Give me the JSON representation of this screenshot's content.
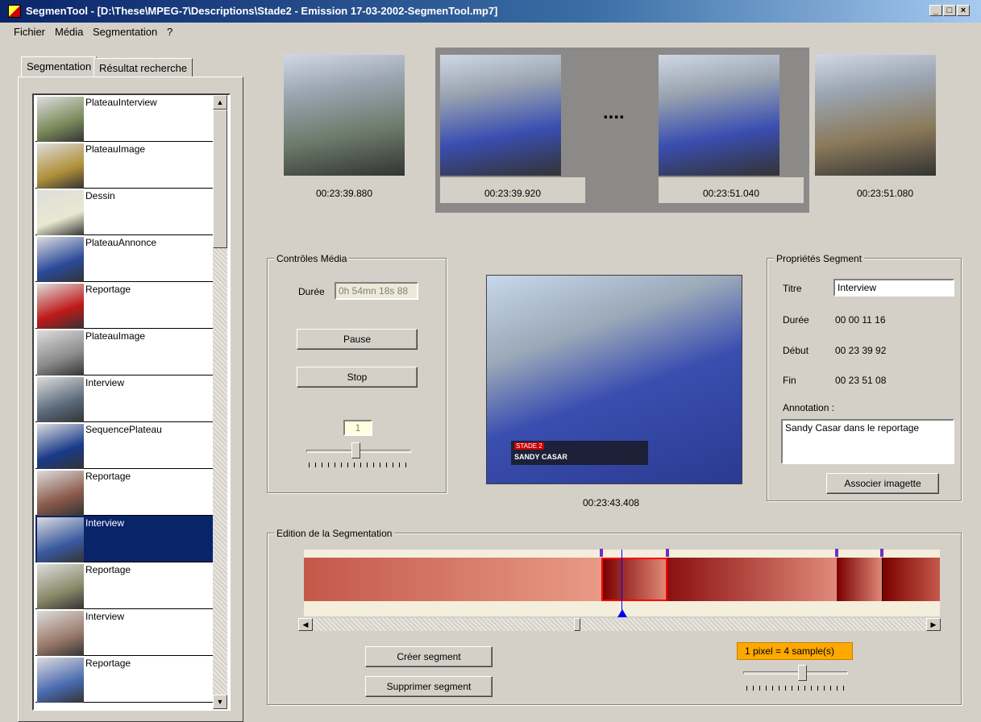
{
  "window": {
    "title": "SegmenTool -  [D:\\These\\MPEG-7\\Descriptions\\Stade2 - Emission 17-03-2002-SegmenTool.mp7]"
  },
  "menu": [
    "Fichier",
    "Média",
    "Segmentation",
    "?"
  ],
  "tabs": [
    "Segmentation",
    "Résultat recherche"
  ],
  "segments": [
    {
      "label": "PlateauInterview",
      "thumb": "#7a8a5a"
    },
    {
      "label": "PlateauImage",
      "thumb": "#b0903a"
    },
    {
      "label": "Dessin",
      "thumb": "#e8e8d0"
    },
    {
      "label": "PlateauAnnonce",
      "thumb": "#2a4a9a"
    },
    {
      "label": "Reportage",
      "thumb": "#c01818"
    },
    {
      "label": "PlateauImage",
      "thumb": "#8a8a8a"
    },
    {
      "label": "Interview",
      "thumb": "#5a6a7a"
    },
    {
      "label": "SequencePlateau",
      "thumb": "#1a3a8a"
    },
    {
      "label": "Reportage",
      "thumb": "#8a5a4a"
    },
    {
      "label": "Interview",
      "thumb": "#3a5aa0"
    },
    {
      "label": "Reportage",
      "thumb": "#8a8a6a"
    },
    {
      "label": "Interview",
      "thumb": "#9a7a6a"
    },
    {
      "label": "Reportage",
      "thumb": "#4a6ab0"
    }
  ],
  "selected_segment_index": 9,
  "frames": [
    {
      "time": "00:23:39.880",
      "color": "#6b7a6a"
    },
    {
      "time": "00:23:39.920",
      "color": "#3a4eb0"
    },
    {
      "time": "00:23:51.040",
      "color": "#3a4eb0"
    },
    {
      "time": "00:23:51.080",
      "color": "#8a7a5a"
    }
  ],
  "frames_separator": "....",
  "media_controls": {
    "group_title": "Contrôles Média",
    "duration_label": "Durée",
    "duration_value": "0h 54mn 18s 88",
    "pause": "Pause",
    "stop": "Stop",
    "speed_value": "1"
  },
  "preview": {
    "time": "00:23:43.408",
    "caption_top": "STADE 2",
    "caption_name": "SANDY CASAR"
  },
  "properties": {
    "group_title": "Propriétés Segment",
    "title_label": "Titre",
    "title_value": "Interview",
    "duration_label": "Durée",
    "duration_value": "00 00 11 16",
    "start_label": "Début",
    "start_value": "00 23 39 92",
    "end_label": "Fin",
    "end_value": "00 23 51 08",
    "annotation_label": "Annotation :",
    "annotation_value": "Sandy Casar dans le reportage",
    "associate_button": "Associer imagette"
  },
  "editing": {
    "group_title": "Edition de la Segmentation",
    "create_button": "Créer segment",
    "delete_button": "Supprimer segment",
    "scale_label": "1 pixel = 4 sample(s)"
  }
}
